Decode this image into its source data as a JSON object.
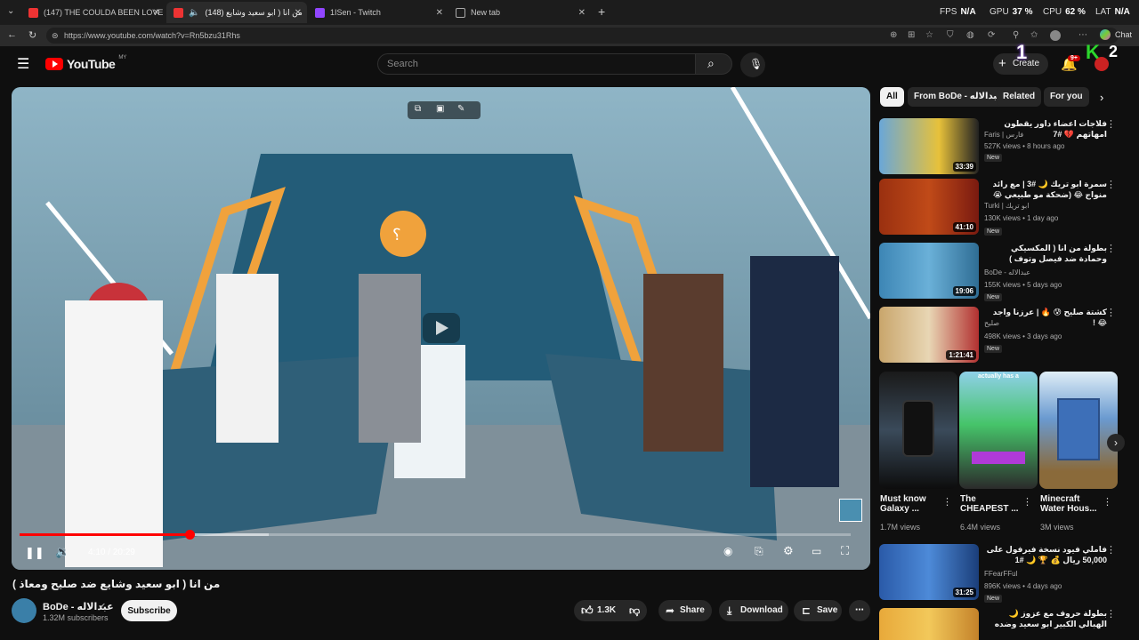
{
  "browser": {
    "tabs": [
      {
        "title": "(147) THE COULDA BEEN LOVE H",
        "active": false
      },
      {
        "title": "(148) من انا ( ابو سعيد وشايع",
        "active": true
      },
      {
        "title": "1ISen - Twitch",
        "active": false
      },
      {
        "title": "New tab",
        "active": false
      }
    ],
    "perf": {
      "fps_label": "FPS",
      "fps": "N/A",
      "gpu_label": "GPU",
      "gpu": "37 %",
      "cpu_label": "CPU",
      "cpu": "62 %",
      "lat_label": "LAT",
      "lat": "N/A"
    },
    "url": "https://www.youtube.com/watch?v=Rn5bzu31Rhs",
    "chat_label": "Chat"
  },
  "youtube": {
    "logo_text": "YouTube",
    "region": "MY",
    "search_placeholder": "Search",
    "create_label": "Create",
    "notif_count": "9+",
    "overlay_numbers": {
      "left": "1",
      "right": "2"
    }
  },
  "player": {
    "current_time": "4:10",
    "duration": "20:29",
    "time_display": "4:10 / 20:29",
    "progress": 0.204,
    "buffered": 0.3
  },
  "video": {
    "title": "من انا ( ابو سعيد وشايع ضد صليح ومعاذ )",
    "channel": "BoDe - عبدالاله",
    "subscribers": "1.32M subscribers",
    "subscribe_label": "Subscribe",
    "likes": "1.3K",
    "share_label": "Share",
    "download_label": "Download",
    "save_label": "Save"
  },
  "sidebar": {
    "chips": [
      "All",
      "From BoDe - عبدالاله",
      "Related",
      "For you"
    ],
    "videos": [
      {
        "title": "فلاجات اعضاء داور يقطون امهاتهم 💔 #7",
        "channel": "Faris | فارس",
        "meta": "527K views • 8 hours ago",
        "duration": "33:39",
        "badge": "New"
      },
      {
        "title": "سمرة ابو تريك 🌙 #3 | مع رائد منواج 😂 (ضحكة مو طبيعي 😭 🔥 !!)",
        "channel": "Turki | ابو تريك",
        "meta": "130K views • 1 day ago",
        "duration": "41:10",
        "badge": "New"
      },
      {
        "title": "بطولة من انا ( المكسيكي وحمادة ضد فيصل وتوف )",
        "channel": "BoDe - عبدالاله",
        "meta": "155K views • 5 days ago",
        "duration": "19:06",
        "badge": "New"
      },
      {
        "title": "كشتة صليح 😰 🔥 | عرزنا واجد 😂 !",
        "channel": "صليح",
        "meta": "498K views • 3 days ago",
        "duration": "1:21:41",
        "badge": "New"
      },
      {
        "title": "فاملي فيود نسخة فيرفول على 50,000 ريال 💰 🏆 🌙 #1",
        "channel": "FFearFFul",
        "meta": "896K views • 4 days ago",
        "duration": "31:25",
        "badge": "New"
      },
      {
        "title": "بطولة حروف مع عزوز 🌙 الهبالي الكبير ابو سعيد وضده ضد عثمان وعامر",
        "channel": "",
        "meta": "",
        "duration": "",
        "badge": ""
      }
    ],
    "shorts": [
      {
        "title": "Must know Galaxy ...",
        "views": "1.7M views",
        "caption": ""
      },
      {
        "title": "The CHEAPEST ...",
        "views": "6.4M views",
        "caption": "actually has a"
      },
      {
        "title": "Minecraft Water Hous...",
        "views": "3M views",
        "caption": ""
      }
    ]
  }
}
